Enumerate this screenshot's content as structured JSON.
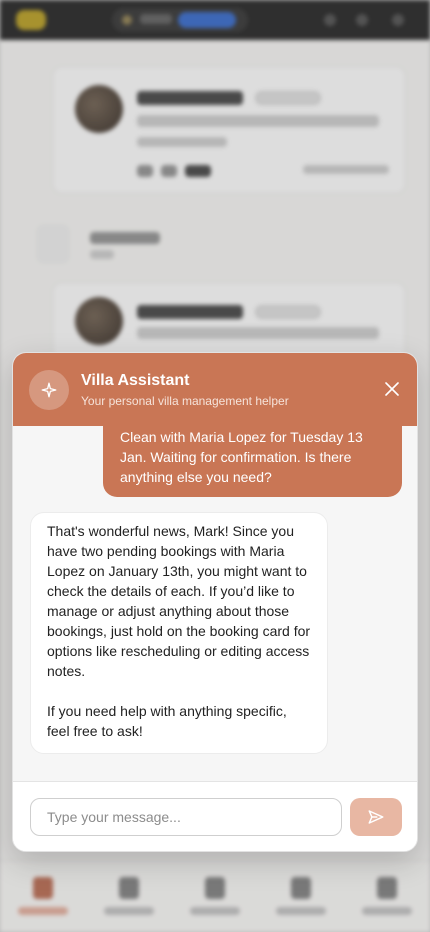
{
  "assistant": {
    "title": "Villa Assistant",
    "subtitle": "Your personal villa management helper",
    "accent_color": "#c97655"
  },
  "messages": [
    {
      "role": "user",
      "text": "Clean with Maria Lopez for Tuesday 13 Jan. Waiting for confirmation. Is there anything else you need?"
    },
    {
      "role": "assistant",
      "paragraphs": [
        "That's wonderful news, Mark! Since you have two pending bookings with Maria Lopez on January 13th, you might want to check the details of each. If you’d like to manage or adjust anything about those bookings, just hold on the booking card for options like rescheduling or editing access notes.",
        "If you need help with anything specific, feel free to ask!"
      ]
    }
  ],
  "composer": {
    "placeholder": "Type your message...",
    "value": ""
  },
  "icons": {
    "assistant_avatar": "sparkle-icon",
    "close": "close-icon",
    "send": "send-icon"
  }
}
